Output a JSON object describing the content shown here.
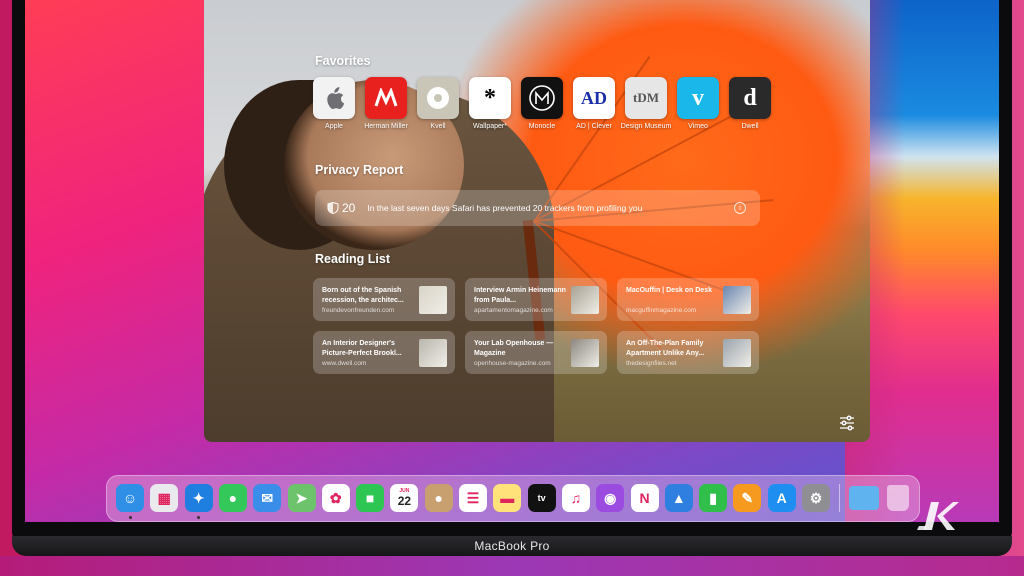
{
  "device": {
    "label": "MacBook Pro"
  },
  "safari": {
    "favorites": {
      "title": "Favorites",
      "items": [
        {
          "label": "Apple",
          "glyph": "",
          "icon": "apple-logo-icon",
          "bg": "#f2f2f2",
          "fg": "#555"
        },
        {
          "label": "Herman Miller",
          "glyph": "",
          "icon": "herman-miller-logo-icon",
          "bg": "#e8201e",
          "fg": "#fff"
        },
        {
          "label": "Kvell",
          "glyph": "",
          "icon": "kvell-logo-icon",
          "bg": "#c9c6b8",
          "fg": "#fff"
        },
        {
          "label": "Wallpaper*",
          "glyph": "*",
          "icon": "wallpaper-logo-icon",
          "bg": "#ffffff",
          "fg": "#000"
        },
        {
          "label": "Monocle",
          "glyph": "M",
          "icon": "monocle-logo-icon",
          "bg": "#111111",
          "fg": "#fff"
        },
        {
          "label": "AD | Clever",
          "glyph": "AD",
          "icon": "ad-clever-logo-icon",
          "bg": "#ffffff",
          "fg": "#1a2fa8"
        },
        {
          "label": "Design Museum",
          "glyph": "tDM",
          "icon": "design-museum-logo-icon",
          "bg": "#e6e6e6",
          "fg": "#555"
        },
        {
          "label": "Vimeo",
          "glyph": "v",
          "icon": "vimeo-logo-icon",
          "bg": "#19b7ea",
          "fg": "#fff"
        },
        {
          "label": "Dwell",
          "glyph": "d",
          "icon": "dwell-logo-icon",
          "bg": "#2a2a2a",
          "fg": "#fff"
        }
      ]
    },
    "privacy": {
      "title": "Privacy Report",
      "count": "20",
      "message": "In the last seven days Safari has prevented 20 trackers from profiling you",
      "info_glyph": "i"
    },
    "reading_list": {
      "title": "Reading List",
      "items": [
        {
          "title": "Born out of the Spanish recession, the architec...",
          "url": "freundevonfreunden.com",
          "thumb": "#d9d4c8"
        },
        {
          "title": "Interview Armin Heinemann from Paula...",
          "url": "apartamentomagazine.com",
          "thumb": "#a8a294"
        },
        {
          "title": "MacOuffin | Desk on Desk",
          "url": "macguffinmagazine.com",
          "thumb": "#6a86b0"
        },
        {
          "title": "An Interior Designer's Picture-Perfect Brookl...",
          "url": "www.dwell.com",
          "thumb": "#b9b6ad"
        },
        {
          "title": "Your Lab Openhouse — Magazine",
          "url": "openhouse-magazine.com",
          "thumb": "#8c8880"
        },
        {
          "title": "An Off-The-Plan Family Apartment Unlike Any...",
          "url": "thedesignfiles.net",
          "thumb": "#9aa3ad"
        }
      ]
    }
  },
  "dock": {
    "apps": [
      {
        "name": "finder",
        "glyph": "☺",
        "bg": "#2f8fe6",
        "running": true
      },
      {
        "name": "launchpad",
        "glyph": "▦",
        "bg": "#e9e9ee",
        "running": false
      },
      {
        "name": "safari",
        "glyph": "✦",
        "bg": "#1e7fe0",
        "running": true
      },
      {
        "name": "messages",
        "glyph": "●",
        "bg": "#34c759",
        "running": false
      },
      {
        "name": "mail",
        "glyph": "✉",
        "bg": "#3a8de8",
        "running": false
      },
      {
        "name": "maps",
        "glyph": "➤",
        "bg": "#6cc36b",
        "running": false
      },
      {
        "name": "photos",
        "glyph": "✿",
        "bg": "#ffffff",
        "running": false
      },
      {
        "name": "facetime",
        "glyph": "■",
        "bg": "#2dc653",
        "running": false
      },
      {
        "name": "calendar",
        "glyph": "22",
        "bg": "#ffffff",
        "running": false
      },
      {
        "name": "contacts",
        "glyph": "●",
        "bg": "#c8a070",
        "running": false
      },
      {
        "name": "reminders",
        "glyph": "☰",
        "bg": "#ffffff",
        "running": false
      },
      {
        "name": "notes",
        "glyph": "▬",
        "bg": "#ffe27a",
        "running": false
      },
      {
        "name": "apple-tv",
        "glyph": "tv",
        "bg": "#111111",
        "running": false
      },
      {
        "name": "music",
        "glyph": "♫",
        "bg": "#ffffff",
        "running": false
      },
      {
        "name": "podcasts",
        "glyph": "◉",
        "bg": "#9b4be0",
        "running": false
      },
      {
        "name": "news",
        "glyph": "N",
        "bg": "#ffffff",
        "running": false
      },
      {
        "name": "keynote",
        "glyph": "▲",
        "bg": "#2f7fe0",
        "running": false
      },
      {
        "name": "numbers",
        "glyph": "▮",
        "bg": "#2fbf4a",
        "running": false
      },
      {
        "name": "pages",
        "glyph": "✎",
        "bg": "#f59a1e",
        "running": false
      },
      {
        "name": "app-store",
        "glyph": "A",
        "bg": "#1e8ff0",
        "running": false
      },
      {
        "name": "system-preferences",
        "glyph": "⚙",
        "bg": "#8e8e93",
        "running": false
      }
    ],
    "calendar_month": "JUN",
    "calendar_day": "22"
  }
}
